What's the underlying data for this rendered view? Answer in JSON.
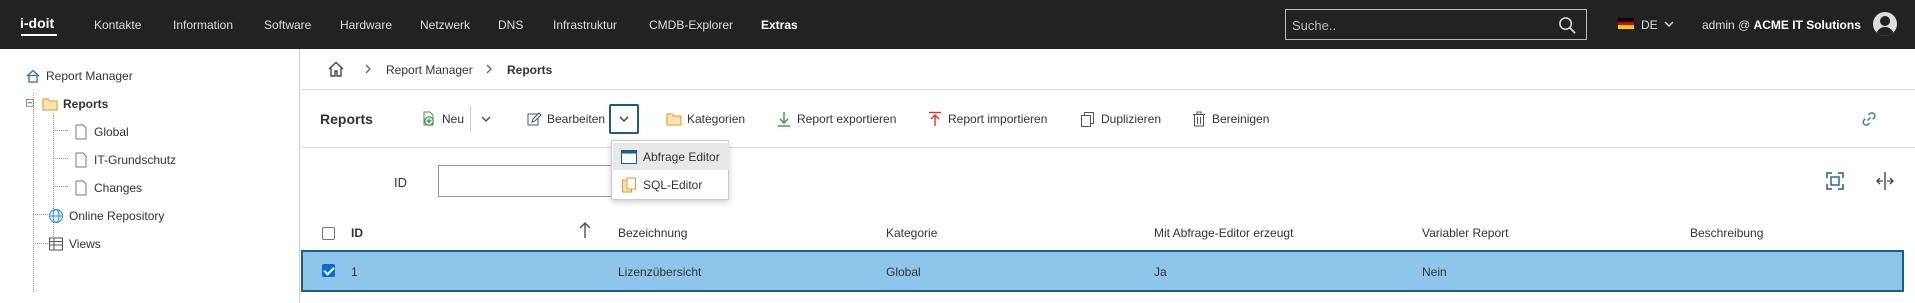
{
  "topbar": {
    "logo": "i-doit",
    "nav": [
      "Kontakte",
      "Information",
      "Software",
      "Hardware",
      "Netzwerk",
      "DNS",
      "Infrastruktur",
      "CMDB-Explorer",
      "Extras"
    ],
    "active_nav": "Extras",
    "search_placeholder": "Suche..",
    "language": "DE",
    "user_prefix": "admin @",
    "user_org": "ACME IT Solutions"
  },
  "sidebar": {
    "items": [
      {
        "label": "Report Manager",
        "icon": "home-icon"
      },
      {
        "label": "Reports",
        "icon": "folder-icon",
        "expanded": true,
        "bold": true
      },
      {
        "label": "Global",
        "icon": "document-icon"
      },
      {
        "label": "IT-Grundschutz",
        "icon": "document-icon"
      },
      {
        "label": "Changes",
        "icon": "document-icon"
      },
      {
        "label": "Online Repository",
        "icon": "globe-icon"
      },
      {
        "label": "Views",
        "icon": "table-icon"
      }
    ]
  },
  "breadcrumb": {
    "items": [
      "Report Manager",
      "Reports"
    ]
  },
  "toolbar": {
    "title": "Reports",
    "new_label": "Neu",
    "edit_label": "Bearbeiten",
    "categories_label": "Kategorien",
    "export_label": "Report exportieren",
    "import_label": "Report importieren",
    "duplicate_label": "Duplizieren",
    "cleanup_label": "Bereinigen"
  },
  "dropdown": {
    "items": [
      "Abfrage Editor",
      "SQL-Editor"
    ]
  },
  "filter": {
    "label": "ID",
    "value": ""
  },
  "table": {
    "columns": [
      "ID",
      "Bezeichnung",
      "Kategorie",
      "Mit Abfrage-Editor erzeugt",
      "Variabler Report",
      "Beschreibung"
    ],
    "rows": [
      {
        "id": "1",
        "name": "Lizenzübersicht",
        "category": "Global",
        "query_editor": "Ja",
        "variable": "Nein",
        "description": "",
        "selected": true
      }
    ]
  },
  "colors": {
    "topbar_bg": "#222222",
    "selected_row_bg": "#8ec5ea",
    "selected_row_border": "#1f5b85",
    "folder_orange": "#f0a030",
    "green_plus": "#2e9c3e",
    "red_arrow": "#d9342b"
  }
}
